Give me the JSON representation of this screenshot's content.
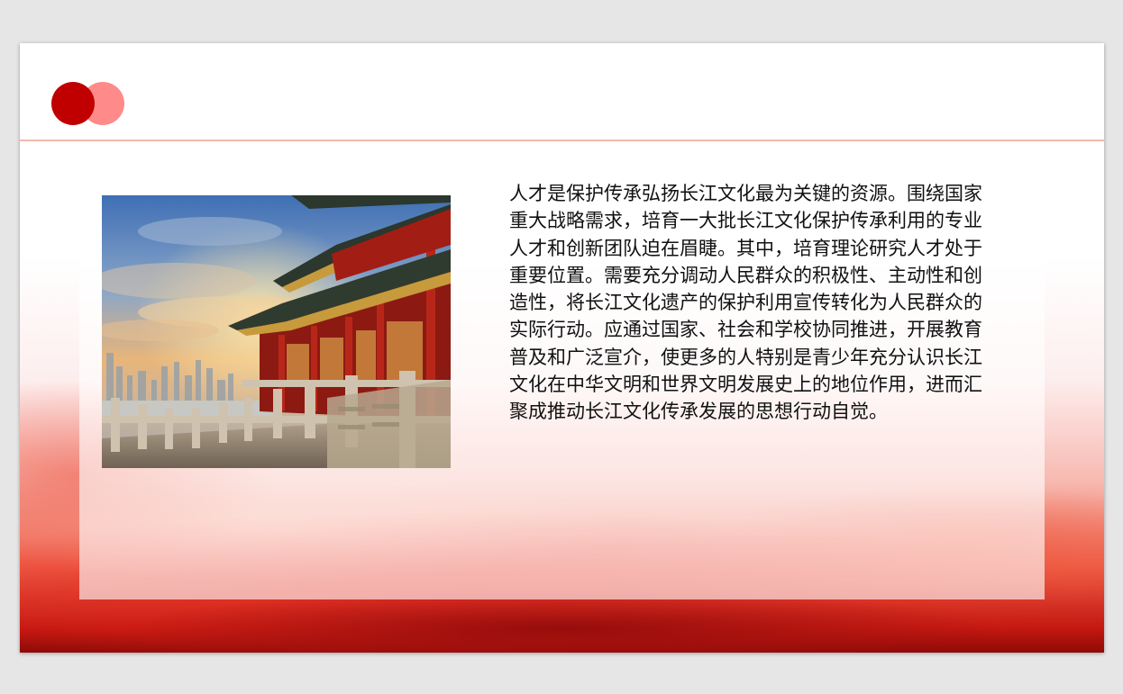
{
  "slide": {
    "accent_colors": {
      "dot_dark": "#c00000",
      "dot_light": "#ff8a8a",
      "header_rule": "#f3b9ad"
    },
    "image": {
      "icon": "palace-photo"
    },
    "body_text": "人才是保护传承弘扬长江文化最为关键的资源。围绕国家重大战略需求，培育一大批长江文化保护传承利用的专业人才和创新团队迫在眉睫。其中，培育理论研究人才处于重要位置。需要充分调动人民群众的积极性、主动性和创造性，将长江文化遗产的保护利用宣传转化为人民群众的实际行动。应通过国家、社会和学校协同推进，开展教育普及和广泛宣介，使更多的人特别是青少年充分认识长江文化在中华文明和世界文明发展史上的地位作用，进而汇聚成推动长江文化传承发展的思想行动自觉。"
  }
}
